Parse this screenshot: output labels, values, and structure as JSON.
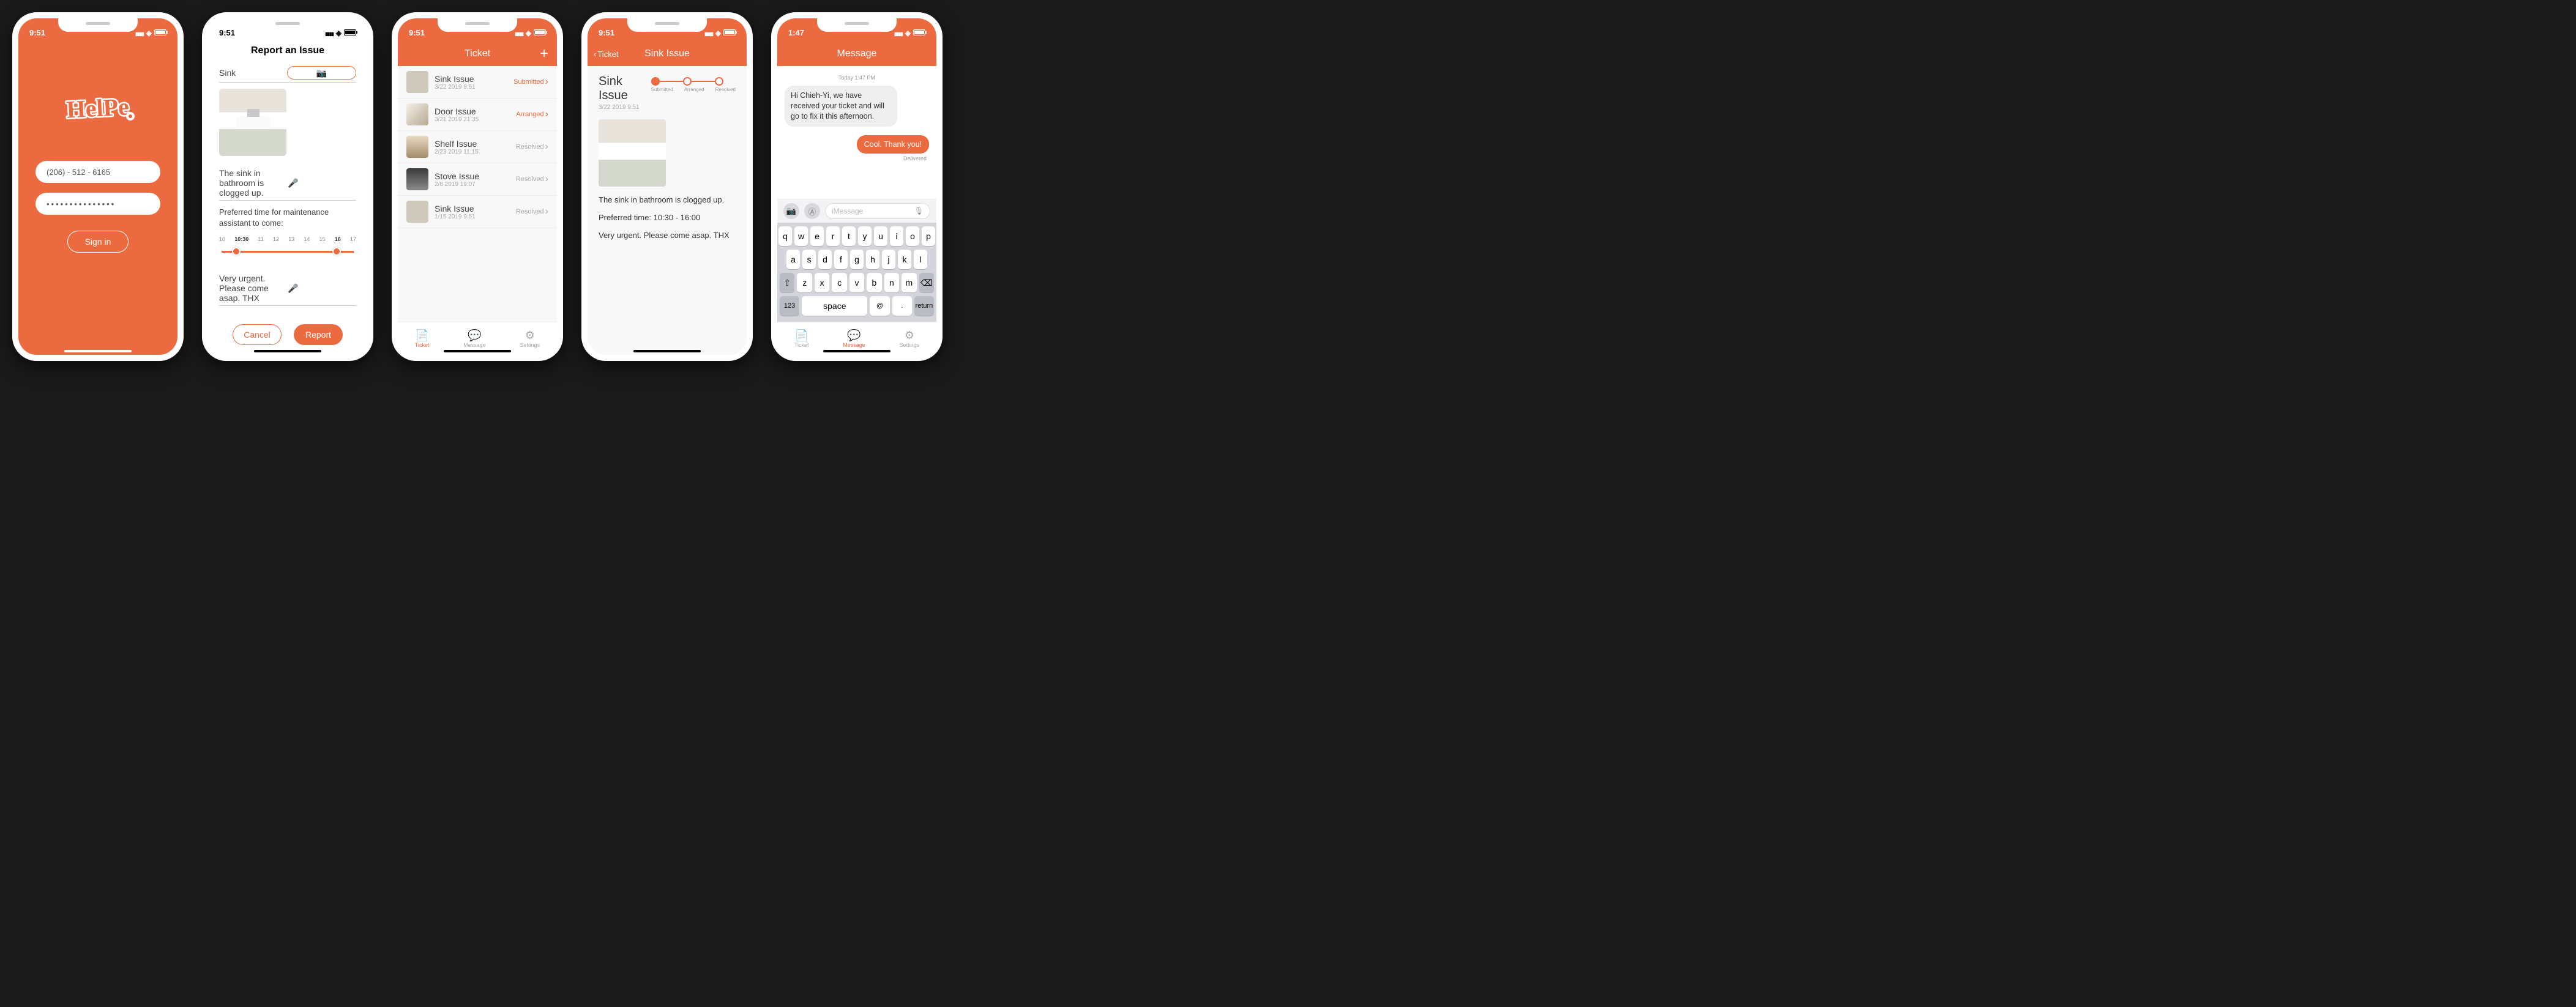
{
  "accent": "#ec6a3f",
  "screen1": {
    "time": "9:51",
    "logo": "HelPe",
    "phone_value": "(206) - 512 - 6165",
    "password_value": "• • • • • • • •",
    "signin_label": "Sign in"
  },
  "screen2": {
    "time": "9:51",
    "title": "Report an Issue",
    "subject_value": "Sink",
    "description_value": "The sink in bathroom is clogged up.",
    "preferred_prompt": "Preferred time for maintenance assistant to come:",
    "scale": [
      "10",
      "10:30",
      "11",
      "12",
      "13",
      "14",
      "15",
      "16",
      "17"
    ],
    "range_start_label": "10:30",
    "range_end_label": "16",
    "extra_note": "Very urgent. Please come asap. THX",
    "cancel_label": "Cancel",
    "report_label": "Report"
  },
  "screen3": {
    "time": "9:51",
    "title": "Ticket",
    "add_glyph": "+",
    "tickets": [
      {
        "title": "Sink Issue",
        "date": "3/22  2019   9:51",
        "status": "Submitted",
        "status_color": "orange",
        "thumb": "sink"
      },
      {
        "title": "Door Issue",
        "date": "3/21  2019   21:35",
        "status": "Arranged",
        "status_color": "orange",
        "thumb": "door"
      },
      {
        "title": "Shelf Issue",
        "date": "2/23  2019   11:15",
        "status": "Resolved",
        "status_color": "gray",
        "thumb": "shelf"
      },
      {
        "title": "Stove Issue",
        "date": "2/8  2019   19:07",
        "status": "Resolved",
        "status_color": "gray",
        "thumb": "stove"
      },
      {
        "title": "Sink Issue",
        "date": "1/15  2019   9:51",
        "status": "Resolved",
        "status_color": "gray",
        "thumb": "sink"
      }
    ],
    "tabs": [
      {
        "label": "Ticket",
        "icon": "📄",
        "active": true
      },
      {
        "label": "Message",
        "icon": "💬",
        "active": false
      },
      {
        "label": "Settings",
        "icon": "⚙",
        "active": false
      }
    ]
  },
  "screen4": {
    "time": "9:51",
    "back_label": "Ticket",
    "title": "Sink Issue",
    "detail_title": "Sink Issue",
    "detail_date": "3/22  2019   9:51",
    "steps": [
      "Submitted",
      "Arranged",
      "Resolved"
    ],
    "desc": "The sink in bathroom is clogged up.",
    "pref": "Preferred time: 10:30 - 16:00",
    "note": "Very urgent. Please come asap. THX"
  },
  "screen5": {
    "time": "1:47",
    "title": "Message",
    "timestamp": "Today 1:47 PM",
    "msg_in": "Hi Chieh-Yi, we have received your ticket and will go to fix it this afternoon.",
    "msg_out": "Cool. Thank you!",
    "delivered": "Delivered",
    "placeholder": "iMessage",
    "key_rows": [
      [
        "q",
        "w",
        "e",
        "r",
        "t",
        "y",
        "u",
        "i",
        "o",
        "p"
      ],
      [
        "a",
        "s",
        "d",
        "f",
        "g",
        "h",
        "j",
        "k",
        "l"
      ],
      [
        "⇧",
        "z",
        "x",
        "c",
        "v",
        "b",
        "n",
        "m",
        "⌫"
      ],
      [
        "123",
        "space",
        "@",
        ".",
        "return"
      ]
    ],
    "tabs": [
      {
        "label": "Ticket",
        "icon": "📄",
        "active": false
      },
      {
        "label": "Message",
        "icon": "💬",
        "active": true
      },
      {
        "label": "Settings",
        "icon": "⚙",
        "active": false
      }
    ]
  }
}
